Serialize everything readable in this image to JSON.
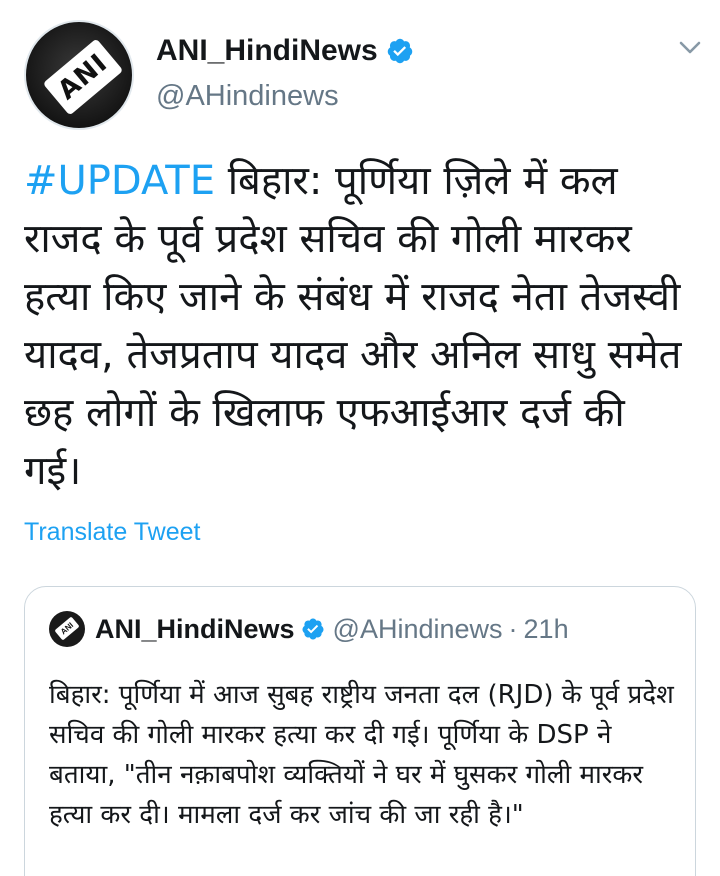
{
  "author": {
    "display_name": "ANI_HindiNews",
    "handle": "@AHindinews",
    "avatar_text": "ANI",
    "verified": true
  },
  "tweet": {
    "hashtag": "#UPDATE",
    "text": " बिहार: पूर्णिया ज़िले में कल राजद के पूर्व प्रदेश सचिव की गोली मारकर हत्या किए जाने के संबंध में राजद नेता तेजस्वी यादव, तेजप्रताप यादव और अनिल साधु समेत छह लोगों के खिलाफ एफआईआर दर्ज की गई।",
    "translate_label": "Translate Tweet"
  },
  "quoted_tweet": {
    "display_name": "ANI_HindiNews",
    "handle": "@AHindinews",
    "separator": "·",
    "time": "21h",
    "text": "बिहार: पूर्णिया में आज सुबह राष्ट्रीय जनता दल (RJD) के पूर्व प्रदेश सचिव की गोली मारकर हत्या कर दी गई। पूर्णिया के DSP ने बताया, \"तीन नक़ाबपोश व्यक्तियों ने घर में घुसकर गोली मारकर हत्या कर दी। मामला दर्ज कर जांच की जा रही है।\""
  },
  "colors": {
    "link": "#1da1f2",
    "secondary_text": "#657786",
    "border": "#ccd6dd"
  },
  "icons": {
    "verified": "verified-badge-icon",
    "more": "chevron-down-icon"
  }
}
